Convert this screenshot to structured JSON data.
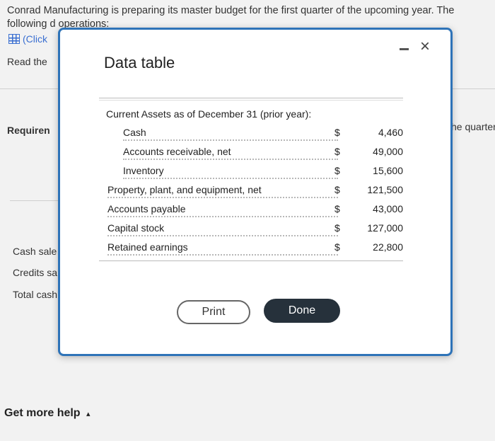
{
  "background": {
    "intro_text": "Conrad Manufacturing is preparing its master budget for the first quarter of the upcoming year. The following d operations:",
    "click_link": "(Click",
    "read_the": "Read the",
    "requirements": "Requiren",
    "right_fragment": "he quarter",
    "cash_sales": "Cash sale",
    "credit_sales": "Credits sa",
    "total_cash": "Total cash",
    "get_more_help": "Get more help",
    "help_arrow": "▴"
  },
  "modal": {
    "title": "Data table",
    "minimize_label": "",
    "close_label": "×",
    "table": {
      "heading": "Current Assets as of December 31 (prior year):",
      "rows": [
        {
          "label": "Cash",
          "currency": "$",
          "value": "4,460"
        },
        {
          "label": "Accounts receivable, net",
          "currency": "$",
          "value": "49,000"
        },
        {
          "label": "Inventory",
          "currency": "$",
          "value": "15,600"
        },
        {
          "label": "Property, plant, and equipment, net",
          "currency": "$",
          "value": "121,500"
        },
        {
          "label": "Accounts payable",
          "currency": "$",
          "value": "43,000"
        },
        {
          "label": "Capital stock",
          "currency": "$",
          "value": "127,000"
        },
        {
          "label": "Retained earnings",
          "currency": "$",
          "value": "22,800"
        }
      ]
    },
    "print_label": "Print",
    "done_label": "Done"
  },
  "colors": {
    "modal_border": "#2e73b8",
    "done_button": "#26313b",
    "link": "#3a6fd1"
  }
}
